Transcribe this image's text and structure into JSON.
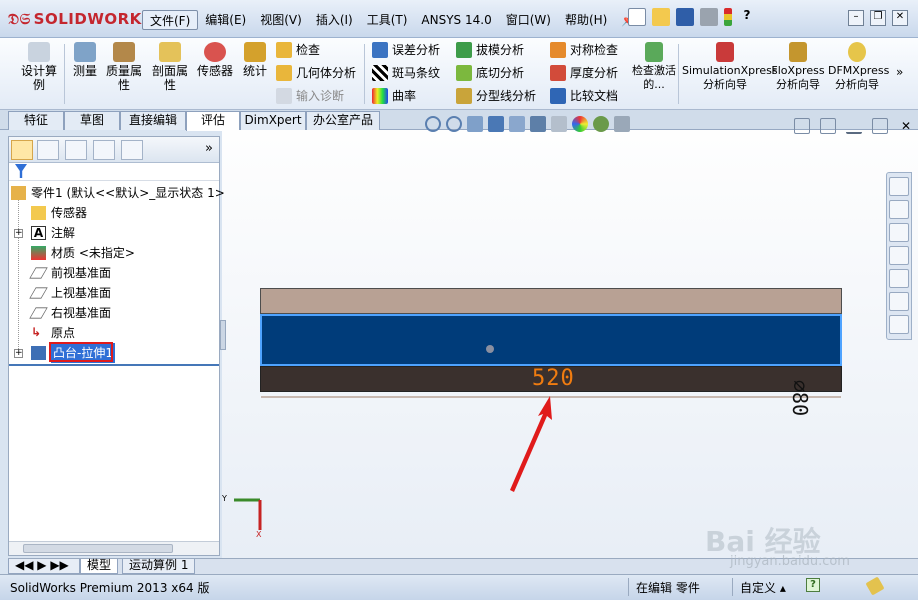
{
  "app": {
    "logo": "SOLIDWORKS"
  },
  "menu": {
    "items": [
      "文件(F)",
      "编辑(E)",
      "视图(V)",
      "插入(I)",
      "工具(T)",
      "ANSYS 14.0",
      "窗口(W)",
      "帮助(H)"
    ]
  },
  "ribbon": {
    "design_study": "设计算例",
    "measure": "测量",
    "mass_props": "质量属性",
    "section_props": "剖面属性",
    "sensor": "传感器",
    "statistics": "统计",
    "check": "检查",
    "geometry_analysis": "几何体分析",
    "import_diagnostics": "输入诊断",
    "deviation_analysis": "误差分析",
    "zebra_stripes": "斑马条纹",
    "curvature": "曲率",
    "draft_analysis": "拔模分析",
    "undercut_analysis": "底切分析",
    "parting_line_analysis": "分型线分析",
    "symmetry_check": "对称检查",
    "thickness_analysis": "厚度分析",
    "compare_documents": "比较文档",
    "check_active": "检查激活的...",
    "simulation_xpress": "SimulationXpress 分析向导",
    "flo_xpress": "FloXpress 分析向导",
    "dfm_xpress": "DFMXpress 分析向导"
  },
  "tabs": [
    "特征",
    "草图",
    "直接编辑",
    "评估",
    "DimXpert",
    "办公室产品"
  ],
  "feature_tree": {
    "root": "零件1 (默认<<默认>_显示状态 1>",
    "items": [
      "传感器",
      "注解",
      "材质 <未指定>",
      "前视基准面",
      "上视基准面",
      "右视基准面",
      "原点",
      "凸台-拉伸1"
    ]
  },
  "graphics": {
    "dimension_length": "520",
    "dimension_diameter": "⌀80",
    "triad_y": "Y",
    "triad_x": "X"
  },
  "bottom_tabs": [
    "模型",
    "运动算例 1"
  ],
  "status": {
    "product": "SolidWorks Premium 2013 x64 版",
    "mode": "在编辑 零件",
    "units": "自定义 ▴"
  },
  "watermark": {
    "text": "Bai 经验",
    "sub": "jingyan.baidu.com"
  },
  "colors": {
    "model_face": "#003c7a",
    "dimension": "#f07c10",
    "highlight": "#e01b1b"
  }
}
